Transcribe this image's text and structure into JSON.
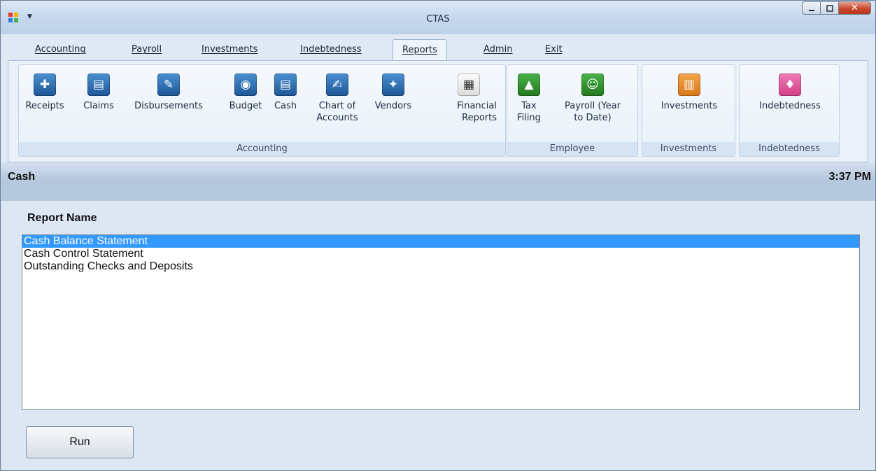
{
  "window": {
    "title": "CTAS"
  },
  "menu": {
    "tabs": [
      {
        "label": "Accounting"
      },
      {
        "label": "Payroll"
      },
      {
        "label": "Investments"
      },
      {
        "label": "Indebtedness"
      },
      {
        "label": "Reports",
        "active": true
      },
      {
        "label": "Admin"
      },
      {
        "label": "Exit"
      }
    ]
  },
  "ribbon": {
    "groups": {
      "accounting": {
        "label": "Accounting",
        "buttons": {
          "receipts": {
            "label": "Receipts",
            "icon": "receipts-icon"
          },
          "claims": {
            "label": "Claims",
            "icon": "claims-icon"
          },
          "disbursements": {
            "label": "Disbursements",
            "icon": "disbursements-icon"
          },
          "budget": {
            "label": "Budget",
            "icon": "piggy-bank-icon"
          },
          "cash": {
            "label": "Cash",
            "icon": "cash-icon"
          },
          "chart_of_accounts": {
            "label_line1": "Chart of",
            "label_line2": "Accounts",
            "icon": "chart-of-accounts-icon"
          },
          "vendors": {
            "label": "Vendors",
            "icon": "handshake-icon"
          },
          "financial_reports": {
            "label_line1": "Financial",
            "label_line2": "Reports",
            "icon": "calculator-icon"
          }
        }
      },
      "employee": {
        "label": "Employee",
        "buttons": {
          "tax_filing": {
            "label_line1": "Tax",
            "label_line2": "Filing",
            "icon": "bank-icon"
          },
          "payroll_ytd": {
            "label_line1": "Payroll (Year",
            "label_line2": "to Date)",
            "icon": "employee-document-icon"
          }
        }
      },
      "investments": {
        "label": "Investments",
        "buttons": {
          "investments": {
            "label": "Investments",
            "icon": "chart-icon"
          }
        }
      },
      "indebtedness": {
        "label": "Indebtedness",
        "buttons": {
          "indebtedness": {
            "label": "Indebtedness",
            "icon": "money-bag-icon"
          }
        }
      }
    }
  },
  "status": {
    "left": "Cash",
    "time": "3:37 PM"
  },
  "main": {
    "report_name_label": "Report Name",
    "reports": [
      {
        "label": "Cash Balance Statement",
        "selected": true
      },
      {
        "label": "Cash Control Statement"
      },
      {
        "label": "Outstanding Checks and Deposits"
      }
    ],
    "run_label": "Run"
  },
  "colors": {
    "selection": "#3399ff",
    "titlebar": "#c4d6ec",
    "close": "#c8472d"
  }
}
